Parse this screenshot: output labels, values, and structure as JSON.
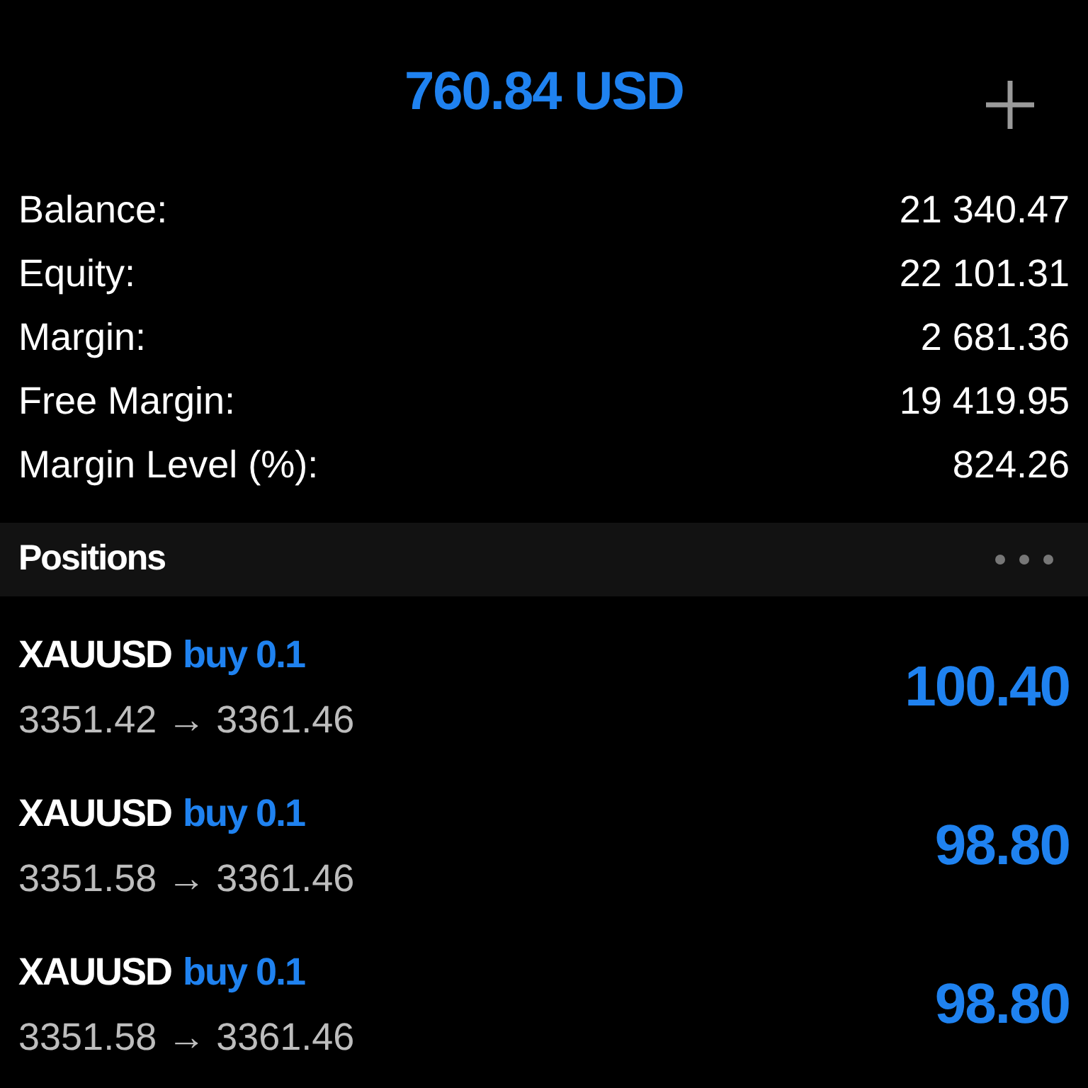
{
  "header": {
    "total": "760.84 USD"
  },
  "summary": [
    {
      "label": "Balance:",
      "value": "21 340.47"
    },
    {
      "label": "Equity:",
      "value": "22 101.31"
    },
    {
      "label": "Margin:",
      "value": "2 681.36"
    },
    {
      "label": "Free Margin:",
      "value": "19 419.95"
    },
    {
      "label": "Margin Level (%):",
      "value": "824.26"
    }
  ],
  "positions_section": {
    "title": "Positions"
  },
  "positions": [
    {
      "symbol": "XAUUSD",
      "order": "buy 0.1",
      "prices": "3351.42 → 3361.46",
      "profit": "100.40"
    },
    {
      "symbol": "XAUUSD",
      "order": "buy 0.1",
      "prices": "3351.58 → 3361.46",
      "profit": "98.80"
    },
    {
      "symbol": "XAUUSD",
      "order": "buy 0.1",
      "prices": "3351.58 → 3361.46",
      "profit": "98.80"
    }
  ]
}
